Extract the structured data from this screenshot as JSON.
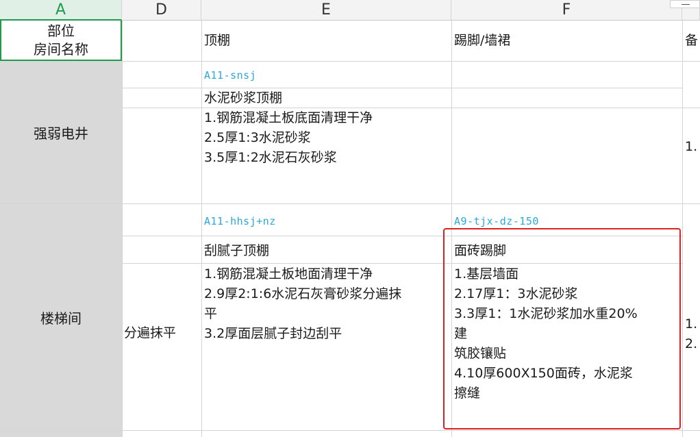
{
  "columns": {
    "a": "A",
    "d": "D",
    "e": "E",
    "f": "F"
  },
  "header": {
    "a_line1": "部位",
    "a_line2": "房间名称",
    "ceiling": "顶棚",
    "baseboard": "踢脚/墙裙",
    "remarks": "备"
  },
  "rows": {
    "shaft": {
      "name": "强弱电井",
      "ceiling_code": "A11-snsj",
      "ceiling_title": "水泥砂浆顶棚",
      "ceiling_steps": [
        "1.钢筋混凝土板底面清理干净",
        "2.5厚1:3水泥砂浆",
        "3.5厚1:2水泥石灰砂浆"
      ],
      "remark_clip": "1."
    },
    "stair": {
      "name": "楼梯间",
      "d_clip": "分遍抹平",
      "ceiling_code": "A11-hhsj+nz",
      "ceiling_title": "刮腻子顶棚",
      "ceiling_steps": [
        "1.钢筋混凝土板地面清理干净",
        "2.9厚2:1:6水泥石灰膏砂浆分遍抹",
        "平",
        "3.2厚面层腻子封边刮平"
      ],
      "base_code": "A9-tjx-dz-150",
      "base_title": "面砖踢脚",
      "base_steps": [
        "1.基层墙面",
        "2.17厚1：3水泥砂浆",
        "3.3厚1：1水泥砂浆加水重20%",
        "建",
        "筑胶镶贴",
        "4.10厚600X150面砖，水泥浆",
        "擦缝"
      ],
      "remark_clip_1": "1.",
      "remark_clip_2": "2."
    }
  },
  "colors": {
    "selection": "#1e9a4b",
    "highlight_box": "#e02020",
    "code_text": "#2aa9d8",
    "room_fill": "#d9d9d9"
  }
}
